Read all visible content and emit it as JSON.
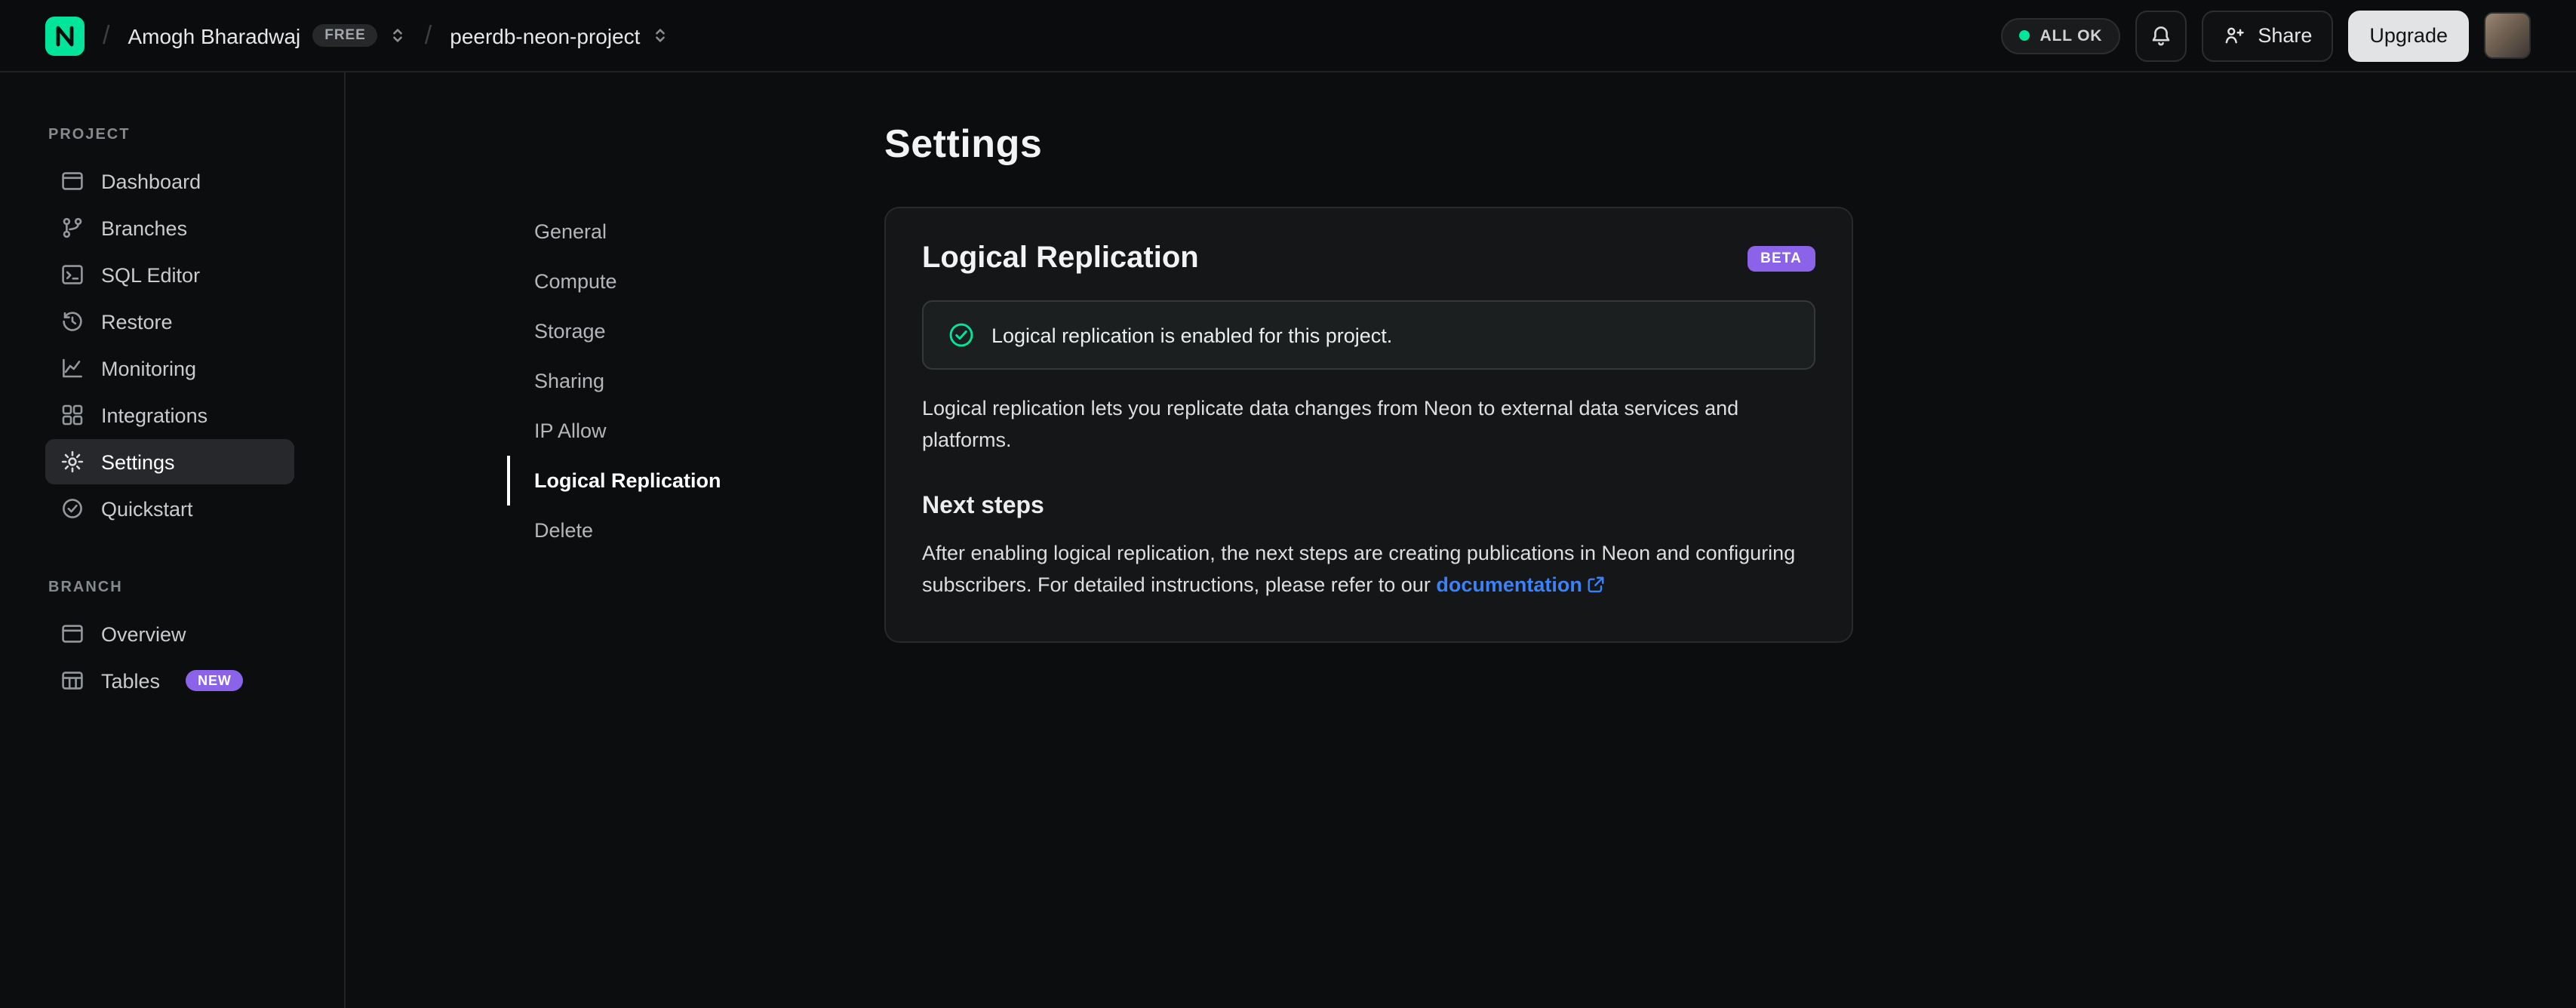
{
  "topbar": {
    "org": {
      "name": "Amogh Bharadwaj",
      "plan_badge": "FREE"
    },
    "project": {
      "name": "peerdb-neon-project"
    },
    "status_label": "ALL OK",
    "share_label": "Share",
    "upgrade_label": "Upgrade"
  },
  "sidebar": {
    "sections": [
      {
        "label": "PROJECT",
        "items": [
          {
            "label": "Dashboard",
            "icon": "dashboard-icon"
          },
          {
            "label": "Branches",
            "icon": "branches-icon"
          },
          {
            "label": "SQL Editor",
            "icon": "sql-editor-icon"
          },
          {
            "label": "Restore",
            "icon": "restore-icon"
          },
          {
            "label": "Monitoring",
            "icon": "monitoring-icon"
          },
          {
            "label": "Integrations",
            "icon": "integrations-icon"
          },
          {
            "label": "Settings",
            "icon": "settings-icon",
            "active": true
          },
          {
            "label": "Quickstart",
            "icon": "quickstart-icon"
          }
        ]
      },
      {
        "label": "BRANCH",
        "items": [
          {
            "label": "Overview",
            "icon": "overview-icon"
          },
          {
            "label": "Tables",
            "icon": "tables-icon",
            "badge": "NEW"
          }
        ]
      }
    ]
  },
  "main": {
    "title": "Settings",
    "nav": {
      "items": [
        "General",
        "Compute",
        "Storage",
        "Sharing",
        "IP Allow",
        "Logical Replication",
        "Delete"
      ],
      "active": "Logical Replication"
    },
    "card": {
      "title": "Logical Replication",
      "badge": "BETA",
      "notice": "Logical replication is enabled for this project.",
      "description": "Logical replication lets you replicate data changes from Neon to external data services and platforms.",
      "next_steps_title": "Next steps",
      "next_steps_text": "After enabling logical replication, the next steps are creating publications in Neon and configuring subscribers. For detailed instructions, please refer to our ",
      "link_label": "documentation"
    }
  },
  "colors": {
    "accent_green": "#00e599",
    "badge_purple": "#8a63e8",
    "link_blue": "#3b82f6",
    "background": "#0c0d0e"
  }
}
